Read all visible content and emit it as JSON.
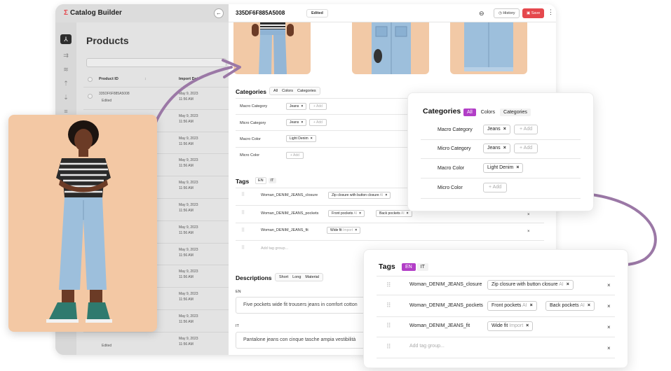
{
  "app": {
    "name": "Catalog Builder",
    "logo_glyph": "Σ",
    "back_icon": "arrow-left-icon"
  },
  "rail": {
    "icons": [
      "grid-icon",
      "filter-icon",
      "layers-icon",
      "upload-icon",
      "download-icon",
      "list-icon"
    ]
  },
  "products": {
    "title": "Products",
    "col_product_id": "Product ID",
    "col_import_date": "Import Date",
    "rows": [
      {
        "id": "335DF6F885A5008",
        "status": "Edited",
        "date": "May 9, 2023",
        "time": "11:56 AM"
      },
      {
        "date": "May 9, 2023",
        "time": "11:56 AM"
      },
      {
        "date": "May 9, 2023",
        "time": "11:56 AM"
      },
      {
        "date": "May 9, 2023",
        "time": "11:56 AM"
      },
      {
        "date": "May 9, 2023",
        "time": "11:56 AM"
      },
      {
        "date": "May 9, 2023",
        "time": "11:56 AM"
      },
      {
        "date": "May 9, 2023",
        "time": "11:56 AM"
      },
      {
        "date": "May 9, 2023",
        "time": "11:56 AM"
      },
      {
        "date": "May 9, 2023",
        "time": "11:56 AM"
      },
      {
        "date": "May 9, 2023",
        "time": "11:56 AM"
      },
      {
        "date": "May 9, 2023",
        "time": "11:56 AM"
      },
      {
        "status": "Edited",
        "date": "May 9, 2023",
        "time": "11:56 AM"
      }
    ]
  },
  "detail": {
    "product_id": "335DF6F885A5008",
    "status_badge": "Edited",
    "history_label": "History",
    "save_label": "Save",
    "categories": {
      "title": "Categories",
      "tabs": [
        "All",
        "Colors",
        "Categories"
      ],
      "rows": [
        {
          "label": "Macro Category",
          "chip": "Jeans",
          "add": "+ Add"
        },
        {
          "label": "Micro Category",
          "chip": "Jeans",
          "add": "+ Add"
        },
        {
          "label": "Macro Color",
          "chip": "Light Denim"
        },
        {
          "label": "Micro Color",
          "add": "+ Add"
        }
      ]
    },
    "tags": {
      "title": "Tags",
      "tabs": [
        "EN",
        "IT"
      ],
      "rows": [
        {
          "name": "Woman_DENIM_JEANS_closure",
          "chips": [
            {
              "text": "Zip closure with button closure",
              "badge": "AI"
            }
          ]
        },
        {
          "name": "Woman_DENIM_JEANS_pockets",
          "chips": [
            {
              "text": "Front pockets",
              "badge": "AI"
            },
            {
              "text": "Back pockets",
              "badge": "AI"
            }
          ]
        },
        {
          "name": "Woman_DENIM_JEANS_fit",
          "chips": [
            {
              "text": "Wide fit",
              "badge": "Import"
            }
          ]
        }
      ],
      "add_placeholder": "Add tag group..."
    },
    "descriptions": {
      "title": "Descriptions",
      "tabs": [
        "Short",
        "Long",
        "Material"
      ],
      "en_label": "EN",
      "en_text": "Five pockets wide fit trousers jeans in comfort cotton",
      "it_label": "IT",
      "it_text": "Pantalone jeans con cinque tasche ampia vestibilità"
    }
  },
  "colors": {
    "accent": "#b23ec7",
    "save": "#e5484d",
    "arrow": "#9b78a6",
    "photo_bg": "#f3c8a4"
  }
}
